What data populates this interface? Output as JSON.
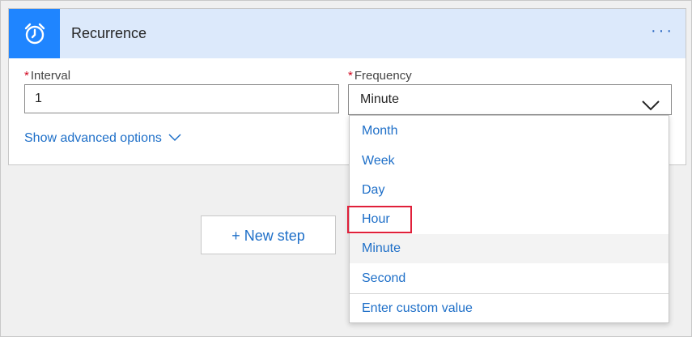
{
  "card": {
    "title": "Recurrence",
    "more_label": "···",
    "header_icon": "alarm-clock-icon"
  },
  "interval": {
    "label": "Interval",
    "required_mark": "*",
    "value": "1"
  },
  "frequency": {
    "label": "Frequency",
    "required_mark": "*",
    "value": "Minute",
    "options": [
      "Month",
      "Week",
      "Day",
      "Hour",
      "Minute",
      "Second"
    ],
    "custom_option": "Enter custom value"
  },
  "advanced": {
    "label": "Show advanced options"
  },
  "new_step": {
    "label": "+ New step"
  },
  "colors": {
    "accent": "#1f85ff",
    "link": "#1e6fc8",
    "header_bg": "#dce9fb",
    "highlight": "#e0203a"
  }
}
